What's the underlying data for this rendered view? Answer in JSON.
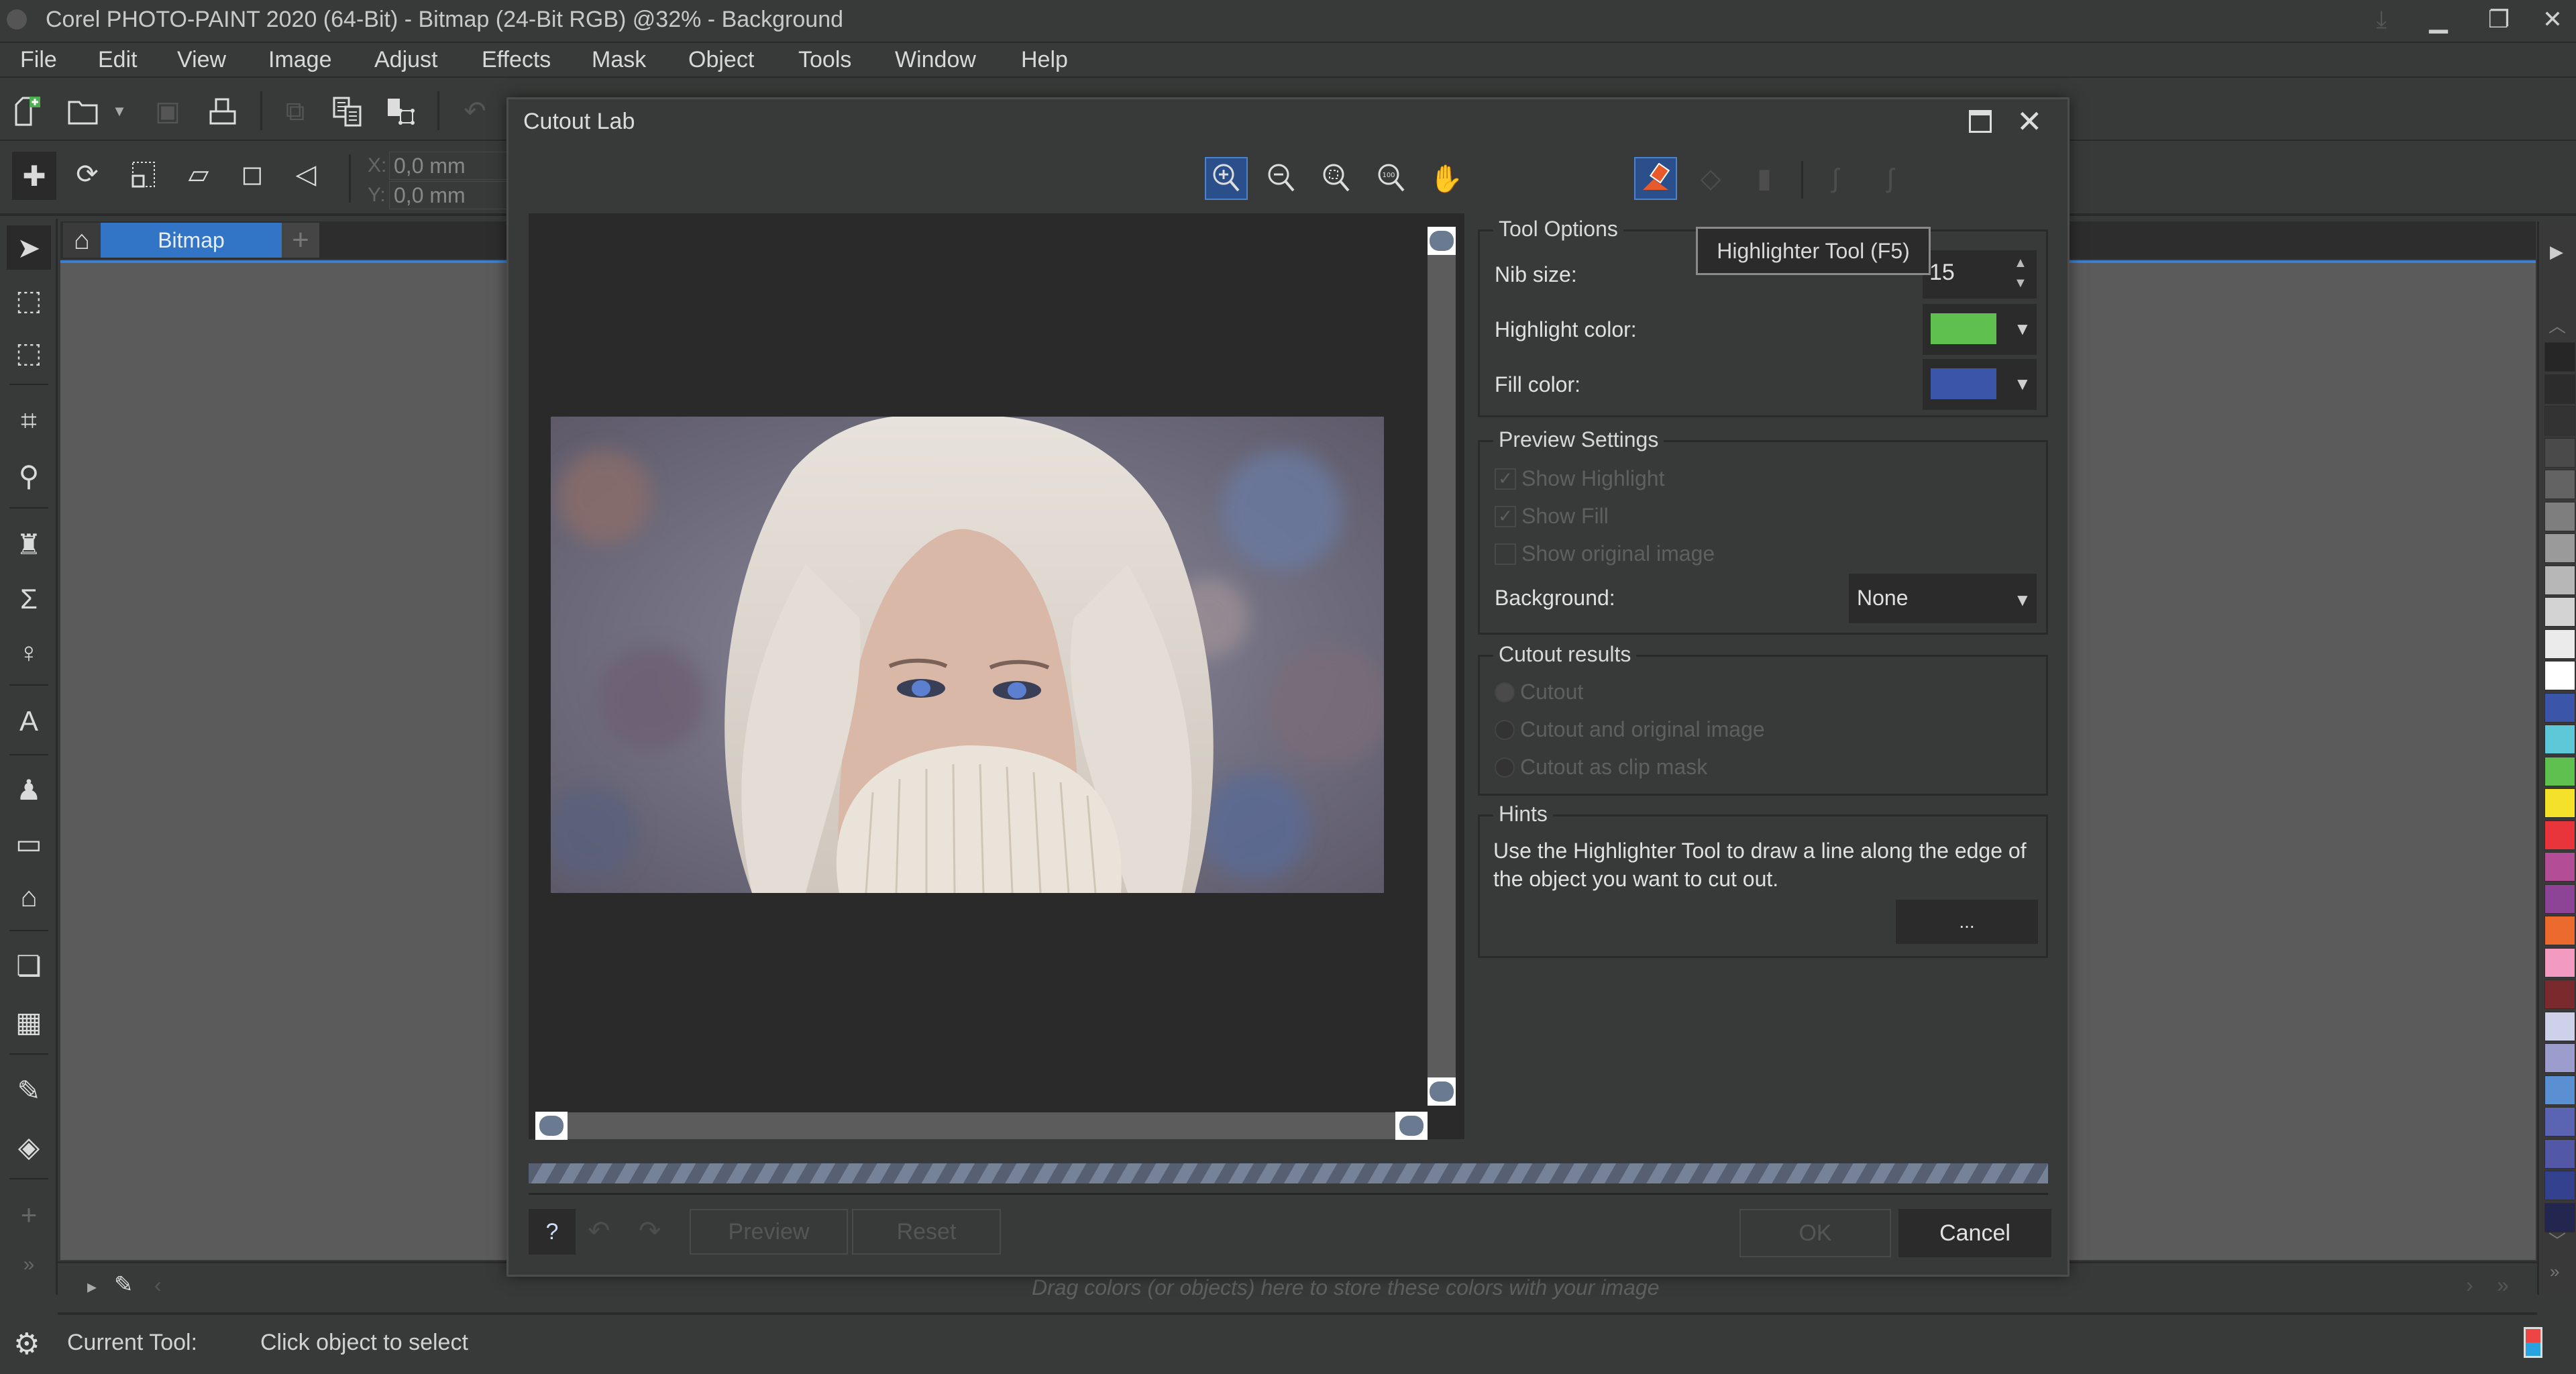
{
  "window": {
    "title": "Corel PHOTO-PAINT 2020 (64-Bit) - Bitmap (24-Bit RGB) @32% - Background",
    "minimize_icon": "minimize-icon",
    "restore_icon": "restore-icon",
    "close_icon": "close-icon"
  },
  "menu": [
    {
      "label": "File"
    },
    {
      "label": "Edit"
    },
    {
      "label": "View"
    },
    {
      "label": "Image"
    },
    {
      "label": "Adjust"
    },
    {
      "label": "Effects"
    },
    {
      "label": "Mask"
    },
    {
      "label": "Object"
    },
    {
      "label": "Tools"
    },
    {
      "label": "Window"
    },
    {
      "label": "Help"
    }
  ],
  "standard_toolbar": [
    {
      "icon": "new-document-icon",
      "enabled": true
    },
    {
      "icon": "open-folder-icon",
      "enabled": true
    },
    {
      "icon": "save-icon",
      "enabled": false
    },
    {
      "icon": "print-icon",
      "enabled": true
    },
    {
      "icon": "cut-icon",
      "enabled": false
    },
    {
      "icon": "copy-icon",
      "enabled": true
    },
    {
      "icon": "paste-as-object-icon",
      "enabled": true
    },
    {
      "icon": "undo-icon",
      "enabled": false
    }
  ],
  "property_bar": {
    "x_label": "X:",
    "x_value": "0,0 mm",
    "y_label": "Y:",
    "y_value": "0,0 mm"
  },
  "document": {
    "tab_label": "Bitmap",
    "home_icon": "home-icon",
    "add_tab_label": "+"
  },
  "dialog": {
    "title": "Cutout Lab",
    "tooltip": "Highlighter Tool (F5)",
    "tool_options": {
      "legend": "Tool Options",
      "nib_size_label": "Nib size:",
      "nib_size_value": "15",
      "highlight_color_label": "Highlight color:",
      "highlight_color": "#5fbf4f",
      "fill_color_label": "Fill color:",
      "fill_color": "#3b55a8"
    },
    "preview_settings": {
      "legend": "Preview Settings",
      "show_highlight": {
        "label": "Show Highlight",
        "checked": true
      },
      "show_fill": {
        "label": "Show Fill",
        "checked": true
      },
      "show_original": {
        "label": "Show original image",
        "checked": false
      },
      "background_label": "Background:",
      "background_value": "None"
    },
    "cutout_results": {
      "legend": "Cutout results",
      "options": [
        {
          "label": "Cutout",
          "selected": true
        },
        {
          "label": "Cutout and original image",
          "selected": false
        },
        {
          "label": "Cutout as clip mask",
          "selected": false
        }
      ]
    },
    "hints": {
      "legend": "Hints",
      "text": "Use the Highlighter Tool to draw a line along the edge of the object you want to cut out.",
      "more_button": "..."
    },
    "buttons": {
      "help": "?",
      "preview": "Preview",
      "reset": "Reset",
      "ok": "OK",
      "cancel": "Cancel"
    }
  },
  "palette_bar": {
    "hint": "Drag colors (or objects) here to store these colors with your image"
  },
  "status": {
    "current_tool_label": "Current Tool:",
    "current_tool_value": "Click object to select"
  },
  "color_palette": [
    "#262626",
    "#2c2c2c",
    "#333333",
    "#4a4a4a",
    "#636363",
    "#7e7e7e",
    "#9a9a9a",
    "#b7b7b7",
    "#d3d3d3",
    "#ebebeb",
    "#ffffff",
    "#3b55a8",
    "#5ec8d8",
    "#5fbf4f",
    "#f3e12a",
    "#e8353b",
    "#b34d96",
    "#8d4497",
    "#ed6a2e",
    "#f29ac0",
    "#7a2a2d",
    "#cfd0ea",
    "#9c9ccd",
    "#5a8fd2",
    "#5b64b2",
    "#5358a6",
    "#33428e",
    "#23264f"
  ]
}
